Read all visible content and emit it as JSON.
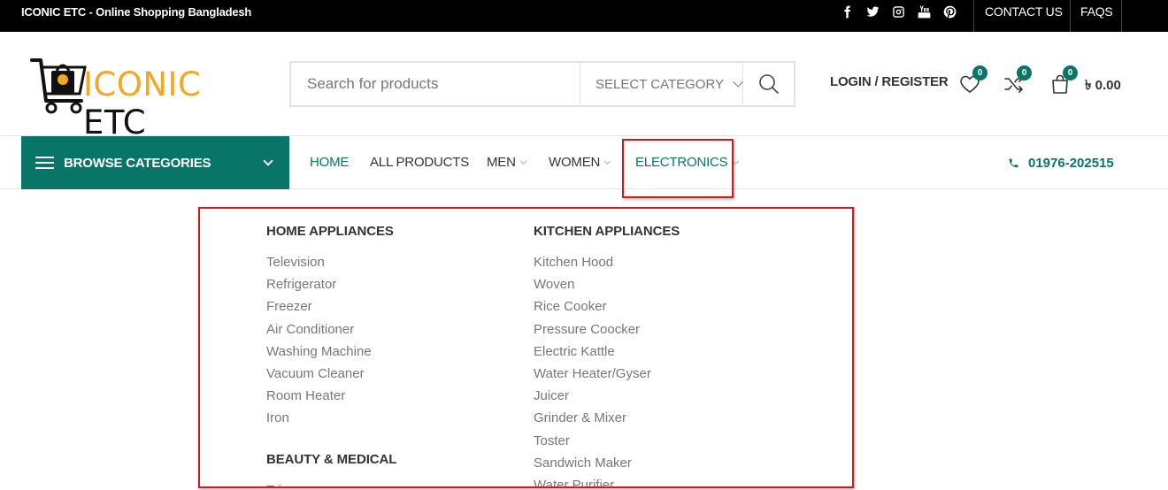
{
  "topbar": {
    "tagline": "ICONIC ETC - Online Shopping Bangladesh",
    "socials": [
      "facebook-icon",
      "twitter-icon",
      "instagram-icon",
      "youtube-icon",
      "pinterest-icon"
    ],
    "links": {
      "contact": "CONTACT US",
      "faqs": "FAQS"
    }
  },
  "header": {
    "logo": {
      "word1": "ICONIC",
      "word2": "ETC"
    },
    "search": {
      "placeholder": "Search for products",
      "category": "SELECT CATEGORY"
    },
    "login": "LOGIN / REGISTER",
    "wishlist_count": "0",
    "compare_count": "0",
    "cart_count": "0",
    "cart_total": "৳ 0.00"
  },
  "nav": {
    "browse": "BROWSE CATEGORIES",
    "items": [
      "HOME",
      "ALL PRODUCTS",
      "MEN",
      "WOMEN",
      "ELECTRONICS"
    ],
    "phone": "01976-202515"
  },
  "mega_menu": {
    "columns": [
      {
        "title": "HOME APPLIANCES",
        "items": [
          "Television",
          "Refrigerator",
          "Freezer",
          "Air Conditioner",
          "Washing Machine",
          "Vacuum Cleaner",
          "Room Heater",
          "Iron"
        ],
        "title2": "BEAUTY & MEDICAL",
        "items2": [
          "Trimmer"
        ]
      },
      {
        "title": "KITCHEN APPLIANCES",
        "items": [
          "Kitchen Hood",
          "Woven",
          "Rice Cooker",
          "Pressure Coocker",
          "Electric Kattle",
          "Water Heater/Gyser",
          "Juicer",
          "Grinder & Mixer",
          "Toster",
          "Sandwich Maker",
          "Water Purifier"
        ]
      }
    ]
  },
  "colors": {
    "accent": "#097468",
    "logo_orange": "#f5a623",
    "highlight": "#d8161c"
  }
}
